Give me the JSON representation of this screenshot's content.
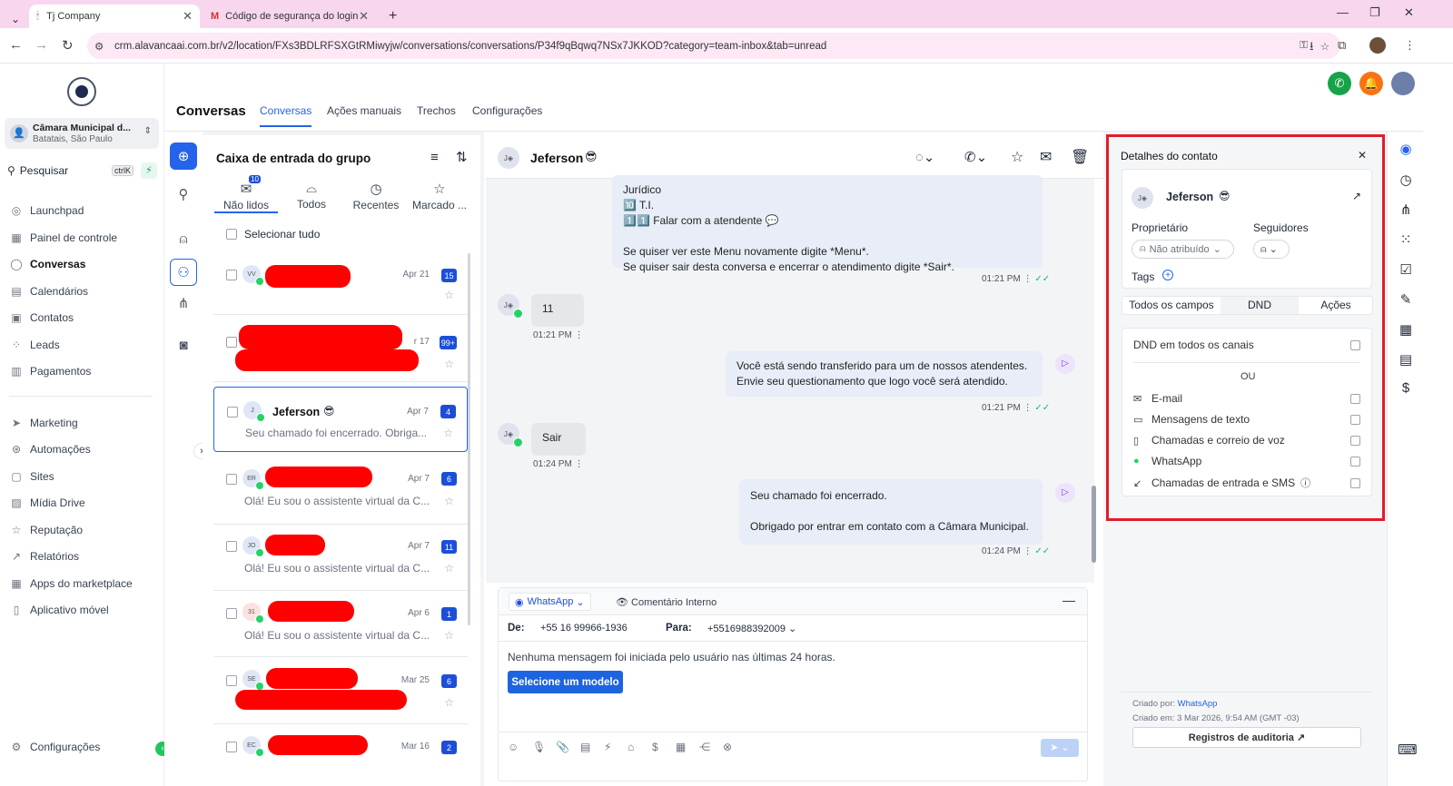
{
  "browser": {
    "tabs": [
      {
        "title": "Tj Company",
        "active": true
      },
      {
        "title": "Código de segurança do login",
        "active": false
      }
    ],
    "url": "crm.alavancaai.com.br/v2/location/FXs3BDLRFSXGtRMiwyjw/conversations/conversations/P34f9qBqwq7NSx7JKKOD?category=team-inbox&tab=unread"
  },
  "sidebar": {
    "account_name": "Câmara Municipal d...",
    "account_location": "Batatais, São Paulo",
    "search_label": "Pesquisar",
    "search_shortcut": "ctrlK",
    "items": [
      {
        "label": "Launchpad",
        "icon": "rocket-icon",
        "active": false
      },
      {
        "label": "Painel de controle",
        "icon": "grid-icon",
        "active": false
      },
      {
        "label": "Conversas",
        "icon": "chat-icon",
        "active": true
      },
      {
        "label": "Calendários",
        "icon": "calendar-icon",
        "active": false
      },
      {
        "label": "Contatos",
        "icon": "contacts-icon",
        "active": false
      },
      {
        "label": "Leads",
        "icon": "leads-icon",
        "active": false
      },
      {
        "label": "Pagamentos",
        "icon": "payments-icon",
        "active": false
      }
    ],
    "items2": [
      {
        "label": "Marketing",
        "icon": "send-icon"
      },
      {
        "label": "Automações",
        "icon": "automation-icon"
      },
      {
        "label": "Sites",
        "icon": "sites-icon"
      },
      {
        "label": "Mídia Drive",
        "icon": "media-icon"
      },
      {
        "label": "Reputação",
        "icon": "star-icon"
      },
      {
        "label": "Relatórios",
        "icon": "chart-icon"
      },
      {
        "label": "Apps do marketplace",
        "icon": "apps-icon"
      },
      {
        "label": "Aplicativo móvel",
        "icon": "phone-icon"
      }
    ],
    "settings_label": "Configurações"
  },
  "header": {
    "title": "Conversas",
    "tabs": [
      {
        "label": "Conversas",
        "active": true
      },
      {
        "label": "Ações manuais",
        "active": false
      },
      {
        "label": "Trechos",
        "active": false
      },
      {
        "label": "Configurações",
        "active": false
      }
    ]
  },
  "inbox": {
    "title": "Caixa de entrada do grupo",
    "tabs": [
      {
        "label": "Não lidos",
        "badge": "10",
        "active": true
      },
      {
        "label": "Todos",
        "active": false
      },
      {
        "label": "Recentes",
        "active": false
      },
      {
        "label": "Marcado ...",
        "active": false
      }
    ],
    "select_all": "Selecionar tudo",
    "conversations": [
      {
        "initials": "VV",
        "date": "Apr 21",
        "badge": "15",
        "name": "",
        "preview": ""
      },
      {
        "initials": "",
        "date": "r 17",
        "badge": "99+",
        "name": "",
        "preview": ""
      },
      {
        "initials": "J",
        "date": "Apr 7",
        "badge": "4",
        "name": "Jeferson",
        "preview": "Seu chamado foi encerrado. Obriga..."
      },
      {
        "initials": "ER",
        "date": "Apr 7",
        "badge": "6",
        "name": "",
        "preview": "Olá! Eu sou o assistente virtual da C..."
      },
      {
        "initials": "JO",
        "date": "Apr 7",
        "badge": "11",
        "name": "",
        "preview": "Olá! Eu sou o assistente virtual da C..."
      },
      {
        "initials": "31",
        "date": "Apr 6",
        "badge": "1",
        "name": "",
        "preview": "Olá! Eu sou o assistente virtual da C..."
      },
      {
        "initials": "SE",
        "date": "Mar 25",
        "badge": "6",
        "name": "",
        "preview": ""
      },
      {
        "initials": "EC",
        "date": "Mar 16",
        "badge": "2",
        "name": "",
        "preview": ""
      }
    ]
  },
  "chat": {
    "contact_name": "Jeferson",
    "messages": [
      {
        "lines": [
          "Jurídico",
          "🔟 T.I.",
          "1️⃣1️⃣ Falar com a atendente 💬",
          "",
          "Se quiser ver este Menu novamente digite *Menu*.",
          "Se quiser sair desta conversa e encerrar o atendimento digite *Sair*."
        ],
        "time": "01:21 PM"
      },
      {
        "text": "11",
        "time": "01:21 PM"
      },
      {
        "lines": [
          "Você está sendo transferido para um de nossos atendentes.",
          "Envie seu questionamento que logo você será atendido."
        ],
        "time": "01:21 PM"
      },
      {
        "text": "Sair",
        "time": "01:24 PM"
      },
      {
        "lines": [
          "Seu chamado foi encerrado.",
          "",
          "Obrigado por entrar em contato com a Câmara Municipal."
        ],
        "time": "01:24 PM"
      }
    ],
    "composer": {
      "channel": "WhatsApp",
      "internal_comment": "Comentário Interno",
      "from_label": "De:",
      "from_value": "+55 16 99966-1936",
      "to_label": "Para:",
      "to_value": "+5516988392009",
      "notice": "Nenhuma mensagem foi iniciada pelo usuário nas últimas 24 horas.",
      "template_button": "Selecione um modelo"
    }
  },
  "details": {
    "title": "Detalhes do contato",
    "contact_name": "Jeferson",
    "owner_label": "Proprietário",
    "owner_value": "Não atribuído",
    "followers_label": "Seguidores",
    "tags_label": "Tags",
    "tabs": [
      {
        "label": "Todos os campos",
        "active": false
      },
      {
        "label": "DND",
        "active": true
      },
      {
        "label": "Ações",
        "active": false
      }
    ],
    "dnd_all": "DND em todos os canais",
    "or_label": "OU",
    "channels": [
      {
        "label": "E-mail",
        "icon": "mail-icon"
      },
      {
        "label": "Mensagens de texto",
        "icon": "sms-icon"
      },
      {
        "label": "Chamadas e correio de voz",
        "icon": "voicemail-icon"
      },
      {
        "label": "WhatsApp",
        "icon": "whatsapp-icon"
      },
      {
        "label": "Chamadas de entrada e SMS",
        "icon": "inbound-icon"
      }
    ],
    "created_by_label": "Criado por:",
    "created_by_value": "WhatsApp",
    "created_on": "Criado em: 3 Mar 2026, 9:54 AM (GMT -03)",
    "audit_button": "Registros de auditoria"
  },
  "colors": {
    "accent": "#2563eb",
    "highlight": "#e11d2a",
    "badge": "#1d4ed8"
  }
}
